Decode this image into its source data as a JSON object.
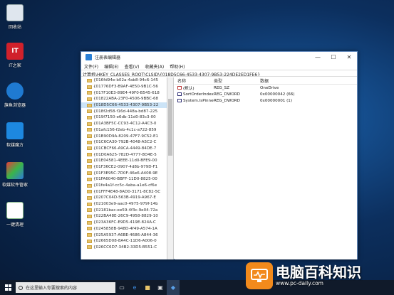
{
  "desktop": {
    "icons": [
      {
        "label": "回收站"
      },
      {
        "label": "IT之家"
      },
      {
        "label": "旗鱼浏览器"
      },
      {
        "label": "软媒魔方"
      },
      {
        "label": "软媒软件管家"
      },
      {
        "label": "一键清理"
      }
    ]
  },
  "window": {
    "title": "注册表编辑器",
    "minimize": "—",
    "maximize": "☐",
    "close": "✕",
    "menu": [
      "文件(F)",
      "编辑(E)",
      "查看(V)",
      "收藏夹(A)",
      "帮助(H)"
    ],
    "address": "计算机\\HKEY_CLASSES_ROOT\\CLSID\\{018D5C66-4533-4307-9B53-224DE2ED1FE6}",
    "tree": [
      "{016fd94e-b02a-4ab8-94c6-145",
      "{01776DF3-B9AF-4E50-9B1C-56",
      "{017F10E3-89E4-49F0-B545-618",
      "{01822ABA-23F0-4506-9BBC-68",
      "{018D5C66-4533-4307-9B53-22",
      "{018f2d58-f16d-448a-bd87-225",
      "{019f7150-e6db-11d0-83c3-00",
      "{01A3BF5C-CC93-4C12-A4C3-0",
      "{01afc156-f2eb-4c1c-a722-859",
      "{01B90D9A-8209-47F7-9C52-E1",
      "{01C6CA30-792B-4048-A5C2-C",
      "{01CBCF66-A9CA-4449-84DE-7",
      "{01D0A625-782D-4777-8D4E-5",
      "{01E04581-4EEE-11d0-BFE9-00",
      "{01F36CE2-0907-4d8b-979D-F1",
      "{01F3E95C-7D0F-46e6-A408-9E",
      "{01FA6040-BBFF-11D0-8825-00",
      "{01fe4a1f-cc5c-4aba-a1e6-cf6e",
      "{01FFF4E48-8AD0-3171-8C82-5C",
      "{0207C04D-563B-4919-A967-E",
      "{021003e9-aac0-4975-979f-14b",
      "{02181bac-ee59-4f3c-9e04-72a",
      "{022BA48E-26C9-4958-8829-10",
      "{023A36FC-E9D5-419E-824A-C",
      "{0245858B-948D-4f49-A574-1A",
      "{025A5937-A6BE-4686-A844-36",
      "{02665D08-8A4C-11D6-A006-0",
      "{026CC6D7-34B2-33D5-B551-C"
    ],
    "selected_index": 4,
    "columns": [
      "名称",
      "类型",
      "数据"
    ],
    "values": [
      {
        "icon": "ab",
        "name": "(默认)",
        "type": "REG_SZ",
        "data": "OneDrive"
      },
      {
        "icon": "dw",
        "name": "SortOrderIndex",
        "type": "REG_DWORD",
        "data": "0x00000042 (66)"
      },
      {
        "icon": "dw",
        "name": "System.IsPinned...",
        "type": "REG_DWORD",
        "data": "0x00000001 (1)"
      }
    ]
  },
  "taskbar": {
    "search_placeholder": "在这里输入你要搜索的内容"
  },
  "watermark": {
    "main": "电脑百科知识",
    "url": "www.pc-daily.com"
  },
  "colors": {
    "accent": "#f28a1c",
    "selection": "#cce4f7"
  }
}
